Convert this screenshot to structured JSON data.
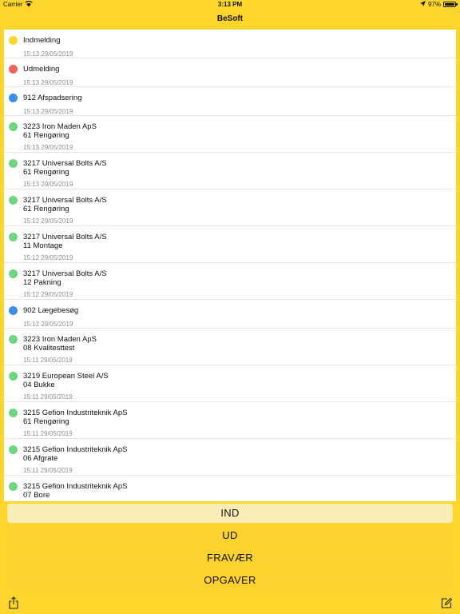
{
  "status_bar": {
    "carrier": "Carrier",
    "time": "3:13 PM",
    "battery": "97%",
    "battery_level": 0.97
  },
  "nav": {
    "title": "BeSoft"
  },
  "colors": {
    "yellow": "#FCD62C",
    "red": "#F0655A",
    "blue": "#3D8EEB",
    "green": "#6FD67F"
  },
  "entries": [
    {
      "status": "yellow",
      "line1": "Indmelding",
      "line2": "",
      "time": "15:13 29/05/2019"
    },
    {
      "status": "red",
      "line1": "Udmelding",
      "line2": "",
      "time": "15:13 29/05/2019"
    },
    {
      "status": "blue",
      "line1": "912 Afspadsering",
      "line2": "",
      "time": "15:13 29/05/2019"
    },
    {
      "status": "green",
      "line1": "3223 Iron Maden ApS",
      "line2": "61 Rengøring",
      "time": "15:13 29/05/2019"
    },
    {
      "status": "green",
      "line1": "3217 Universal Bolts A/S",
      "line2": "61 Rengøring",
      "time": "15:13 29/05/2019"
    },
    {
      "status": "green",
      "line1": "3217 Universal Bolts A/S",
      "line2": "61 Rengøring",
      "time": "15:12 29/05/2019"
    },
    {
      "status": "green",
      "line1": "3217 Universal Bolts A/S",
      "line2": "11 Montage",
      "time": "15:12 29/05/2019"
    },
    {
      "status": "green",
      "line1": "3217 Universal Bolts A/S",
      "line2": "12 Pakning",
      "time": "15:12 29/05/2019"
    },
    {
      "status": "blue",
      "line1": "902 Lægebesøg",
      "line2": "",
      "time": "15:12 29/05/2019"
    },
    {
      "status": "green",
      "line1": "3223 Iron Maden ApS",
      "line2": "08 Kvalitesttest",
      "time": "15:11 29/05/2019"
    },
    {
      "status": "green",
      "line1": "3219 European Steel A/S",
      "line2": "04 Bukke",
      "time": "15:11 29/05/2019"
    },
    {
      "status": "green",
      "line1": "3215 Gefion Industriteknik ApS",
      "line2": "61 Rengøring",
      "time": "15:11 29/05/2019"
    },
    {
      "status": "green",
      "line1": "3215 Gefion Industriteknik ApS",
      "line2": "06 Afgrate",
      "time": "15:11 29/05/2019"
    },
    {
      "status": "green",
      "line1": "3215 Gefion Industriteknik ApS",
      "line2": "07 Bore",
      "time": ""
    }
  ],
  "buttons": {
    "ind": "IND",
    "ud": "UD",
    "fravaer": "FRAVÆR",
    "opgaver": "OPGAVER"
  },
  "toolbar": {
    "left_icon": "share-icon",
    "right_icon": "compose-icon"
  }
}
